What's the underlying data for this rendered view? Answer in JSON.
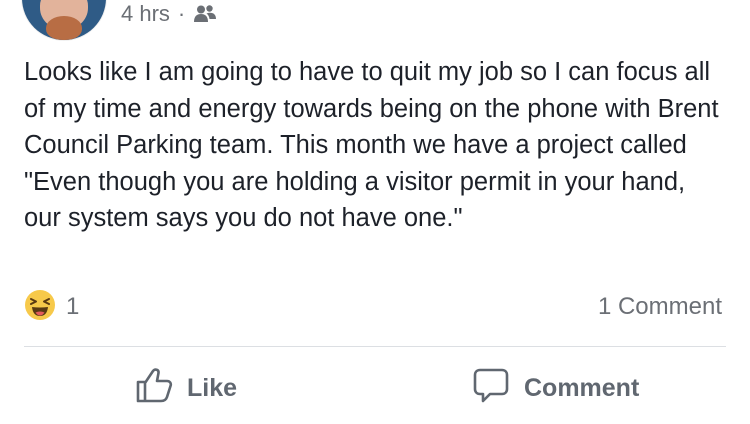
{
  "post": {
    "timestamp": "4 hrs",
    "separator": "·",
    "audience_icon": "friends-icon",
    "text": "Looks like I am going to have to quit my job so I can focus all of my time and energy towards being on the phone with Brent Council Parking team. This month we have a project called \"Even though you are holding a visitor permit in your hand, our system says you do not have one.\""
  },
  "reactions": {
    "icon": "laughing-emoji-icon",
    "count": "1"
  },
  "comments": {
    "count_label": "1 Comment"
  },
  "actions": {
    "like_label": "Like",
    "like_icon": "thumbs-up-icon",
    "comment_label": "Comment",
    "comment_icon": "speech-bubble-icon"
  },
  "colors": {
    "text": "#1d2129",
    "secondary": "#6b6f75",
    "action": "#606770",
    "divider": "#dcdfe3",
    "emoji_yellow": "#f7c94a"
  }
}
